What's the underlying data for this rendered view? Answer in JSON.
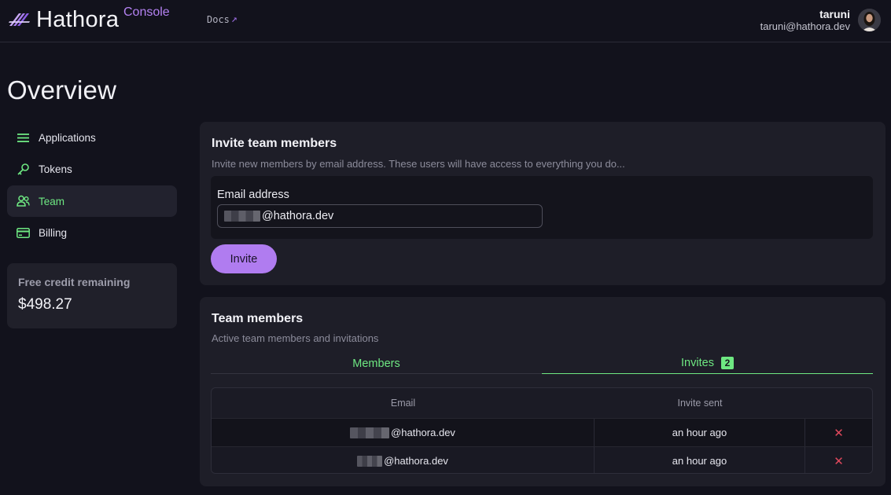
{
  "header": {
    "logo_text": "Hathora",
    "logo_suffix": "Console",
    "docs_label": "Docs",
    "docs_icon": "external-arrow-icon",
    "user_name": "taruni",
    "user_email": "taruni@hathora.dev"
  },
  "page": {
    "title": "Overview"
  },
  "sidebar": {
    "items": [
      {
        "label": "Applications",
        "icon": "list-icon",
        "active": false
      },
      {
        "label": "Tokens",
        "icon": "key-icon",
        "active": false
      },
      {
        "label": "Team",
        "icon": "users-icon",
        "active": true
      },
      {
        "label": "Billing",
        "icon": "credit-card-icon",
        "active": false
      }
    ],
    "credit": {
      "label": "Free credit remaining",
      "value": "$498.27"
    }
  },
  "invite": {
    "title": "Invite team members",
    "subtitle": "Invite new members by email address. These users will have access to everything you do...",
    "email_label": "Email address",
    "email_value": "@hathora.dev",
    "button_label": "Invite"
  },
  "team": {
    "title": "Team members",
    "subtitle": "Active team members and invitations",
    "tabs": [
      {
        "label": "Members",
        "active": false
      },
      {
        "label": "Invites",
        "active": true,
        "badge": "2"
      }
    ],
    "columns": [
      "Email",
      "Invite sent"
    ],
    "rows": [
      {
        "email": "@hathora.dev",
        "sent": "an hour ago",
        "action_icon": "close-icon"
      },
      {
        "email": "@hathora.dev",
        "sent": "an hour ago",
        "action_icon": "close-icon"
      }
    ]
  },
  "colors": {
    "accent_green": "#6ee882",
    "accent_purple": "#b07cf0",
    "danger_red": "#e0485c",
    "background": "#12121c",
    "panel": "#1e1e28"
  }
}
